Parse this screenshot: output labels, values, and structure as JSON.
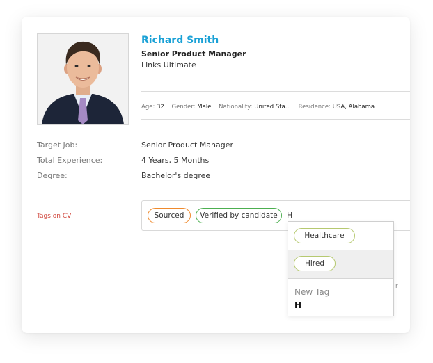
{
  "profile": {
    "name": "Richard Smith",
    "title": "Senior Product Manager",
    "company": "Links Ultimate"
  },
  "details": [
    {
      "label": "Age:",
      "value": "32"
    },
    {
      "label": "Gender:",
      "value": "Male"
    },
    {
      "label": "Nationality:",
      "value": "United Sta..."
    },
    {
      "label": "Residence:",
      "value": "USA, Alabama"
    }
  ],
  "summary": {
    "target_job_label": "Target Job:",
    "target_job_value": "Senior Product Manager",
    "experience_label": "Total Experience:",
    "experience_value": "4 Years, 5 Months",
    "degree_label": "Degree:",
    "degree_value": "Bachelor's degree"
  },
  "tags": {
    "label": "Tags on CV",
    "chips": [
      {
        "text": "Sourced",
        "color": "#ef8a2d"
      },
      {
        "text": "Verified by candidate",
        "color": "#4caf50"
      }
    ],
    "typed_text": "H"
  },
  "dropdown": {
    "suggestions": [
      {
        "text": "Healthcare",
        "color": "#b6c970"
      },
      {
        "text": "Hired",
        "color": "#b6c970"
      }
    ],
    "new_tag_label": "New Tag",
    "new_tag_value": "H"
  },
  "edge_text": "r",
  "colors": {
    "name": "#1aa1d6",
    "tags_label": "#d0443a"
  }
}
